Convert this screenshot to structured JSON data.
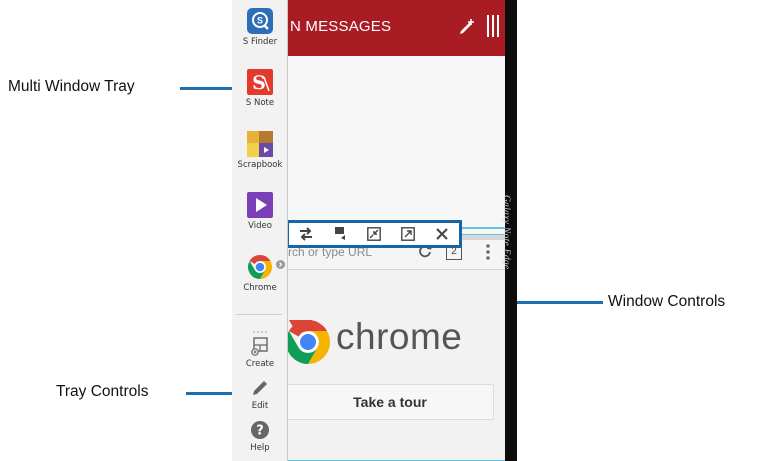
{
  "annotations": {
    "multi_window_tray": "Multi Window Tray",
    "window_controls": "Window Controls",
    "tray_controls": "Tray Controls"
  },
  "messages_app": {
    "title": "N MESSAGES",
    "header_color": "#a91c24"
  },
  "tray": {
    "apps": [
      {
        "label": "S Finder",
        "icon": "s-finder-icon"
      },
      {
        "label": "S Note",
        "icon": "s-note-icon"
      },
      {
        "label": "Scrapbook",
        "icon": "scrapbook-icon"
      },
      {
        "label": "Video",
        "icon": "video-icon"
      },
      {
        "label": "Chrome",
        "icon": "chrome-icon"
      }
    ],
    "controls": [
      {
        "label": "Create",
        "icon": "create-icon"
      },
      {
        "label": "Edit",
        "icon": "edit-icon"
      },
      {
        "label": "Help",
        "icon": "help-icon"
      }
    ]
  },
  "window_controls": {
    "buttons": [
      "switch-windows-icon",
      "drag-content-icon",
      "minimize-window-icon",
      "maximize-window-icon",
      "close-window-icon"
    ],
    "accent": "#1565a7"
  },
  "chrome_app": {
    "url_placeholder": "rch or type URL",
    "tab_count": "2",
    "wordmark": "chrome",
    "tour_button": "Take a tour"
  },
  "device_edge_text": "Galaxy Note Edge"
}
